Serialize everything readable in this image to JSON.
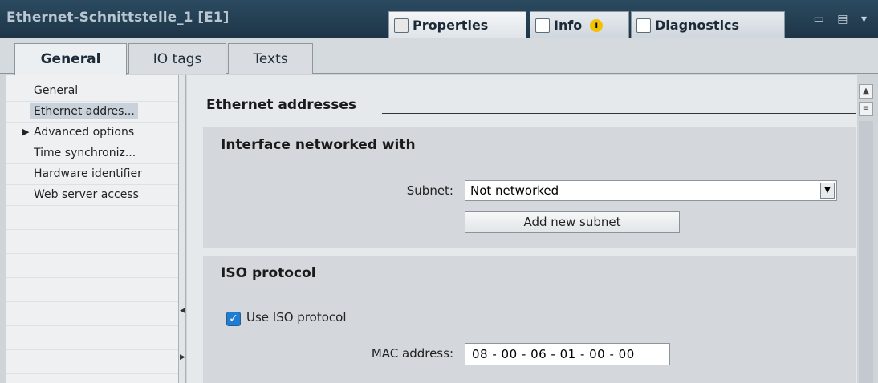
{
  "window": {
    "title": "Ethernet-Schnittstelle_1 [E1]",
    "tabs": [
      {
        "label": "Properties",
        "icon": "properties-icon"
      },
      {
        "label": "Info",
        "icon": "info-icon"
      },
      {
        "label": "Diagnostics",
        "icon": "diagnostics-icon"
      }
    ]
  },
  "tabs": [
    {
      "label": "General"
    },
    {
      "label": "IO tags"
    },
    {
      "label": "Texts"
    }
  ],
  "sidebar": {
    "items": [
      {
        "label": "General"
      },
      {
        "label": "Ethernet addres..."
      },
      {
        "label": "Advanced options"
      },
      {
        "label": "Time synchroniz..."
      },
      {
        "label": "Hardware identifier"
      },
      {
        "label": "Web server access"
      }
    ]
  },
  "main": {
    "heading": "Ethernet addresses",
    "interface": {
      "title": "Interface networked with",
      "subnet_label": "Subnet:",
      "subnet_value": "Not networked",
      "add_subnet_label": "Add new subnet"
    },
    "iso": {
      "title": "ISO protocol",
      "use_iso_label": "Use ISO protocol",
      "use_iso_checked": true,
      "mac_label": "MAC address:",
      "mac_value": "08 - 00 - 06 - 01 - 00 - 00"
    }
  },
  "colors": {
    "titlebar": "#1e3547",
    "accent": "#1e7dd0"
  }
}
